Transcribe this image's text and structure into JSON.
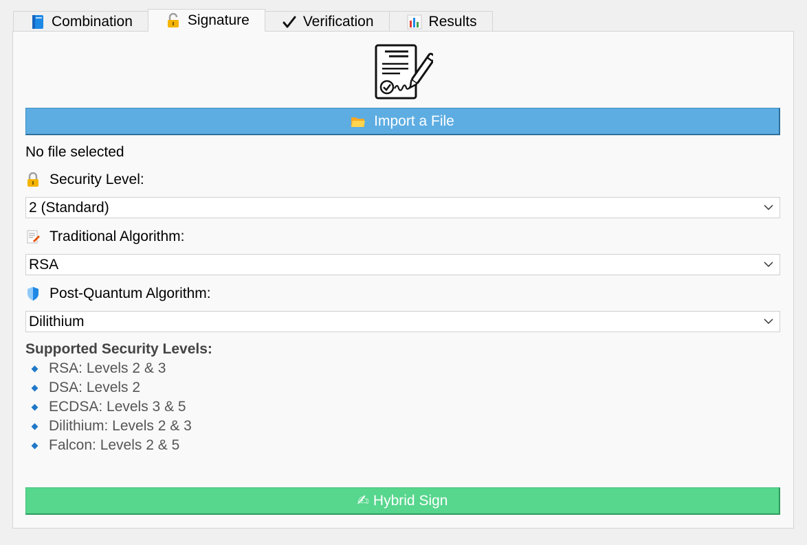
{
  "tabs": [
    {
      "label": "Combination",
      "icon": "blue-book-icon",
      "active": false
    },
    {
      "label": "Signature",
      "icon": "lock-with-pen-icon",
      "active": true
    },
    {
      "label": "Verification",
      "icon": "check-mark-icon",
      "active": false
    },
    {
      "label": "Results",
      "icon": "bar-chart-icon",
      "active": false
    }
  ],
  "header_icon": "signed-document-icon",
  "import_button": {
    "label": "Import a File",
    "icon": "folder-icon",
    "color": "#5dade2"
  },
  "file_status": "No file selected",
  "security_level": {
    "label": "Security Level:",
    "icon": "lock-icon",
    "value": "2 (Standard)"
  },
  "traditional_algorithm": {
    "label": "Traditional Algorithm:",
    "icon": "memo-icon",
    "value": "RSA"
  },
  "post_quantum_algorithm": {
    "label": "Post-Quantum Algorithm:",
    "icon": "shield-icon",
    "value": "Dilithium"
  },
  "supported": {
    "title": "Supported Security Levels:",
    "items": [
      "RSA: Levels 2 & 3",
      "DSA: Levels 2",
      "ECDSA: Levels 3 & 5",
      "Dilithium: Levels 2 & 3",
      "Falcon: Levels 2 & 5"
    ]
  },
  "sign_button": {
    "label": "✍ Hybrid Sign",
    "color": "#57d68d"
  }
}
